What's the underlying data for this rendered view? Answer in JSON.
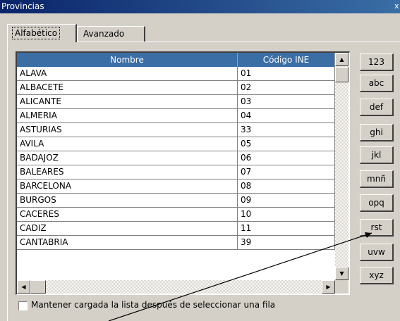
{
  "window": {
    "title": "Provincias",
    "close_glyph": "x"
  },
  "tabs": [
    {
      "label": "Alfabético",
      "active": true
    },
    {
      "label": "Avanzado",
      "active": false
    }
  ],
  "grid": {
    "columns": [
      "Nombre",
      "Código INE"
    ],
    "header_color": "#3a6ea5",
    "rows": [
      {
        "nombre": "ALAVA",
        "codigo": "01"
      },
      {
        "nombre": "ALBACETE",
        "codigo": "02"
      },
      {
        "nombre": "ALICANTE",
        "codigo": "03"
      },
      {
        "nombre": "ALMERIA",
        "codigo": "04"
      },
      {
        "nombre": "ASTURIAS",
        "codigo": "33"
      },
      {
        "nombre": "AVILA",
        "codigo": "05"
      },
      {
        "nombre": "BADAJOZ",
        "codigo": "06"
      },
      {
        "nombre": "BALEARES",
        "codigo": "07"
      },
      {
        "nombre": "BARCELONA",
        "codigo": "08"
      },
      {
        "nombre": "BURGOS",
        "codigo": "09"
      },
      {
        "nombre": "CACERES",
        "codigo": "10"
      },
      {
        "nombre": "CADIZ",
        "codigo": "11"
      },
      {
        "nombre": "CANTABRIA",
        "codigo": "39"
      }
    ]
  },
  "alpha_buttons": [
    "123",
    "abc",
    "def",
    "ghi",
    "jkl",
    "mnñ",
    "opq",
    "rst",
    "uvw",
    "xyz"
  ],
  "options": {
    "keep_loaded_label": "Mantener cargada la lista después de seleccionar una fila",
    "keep_loaded_checked": false
  }
}
